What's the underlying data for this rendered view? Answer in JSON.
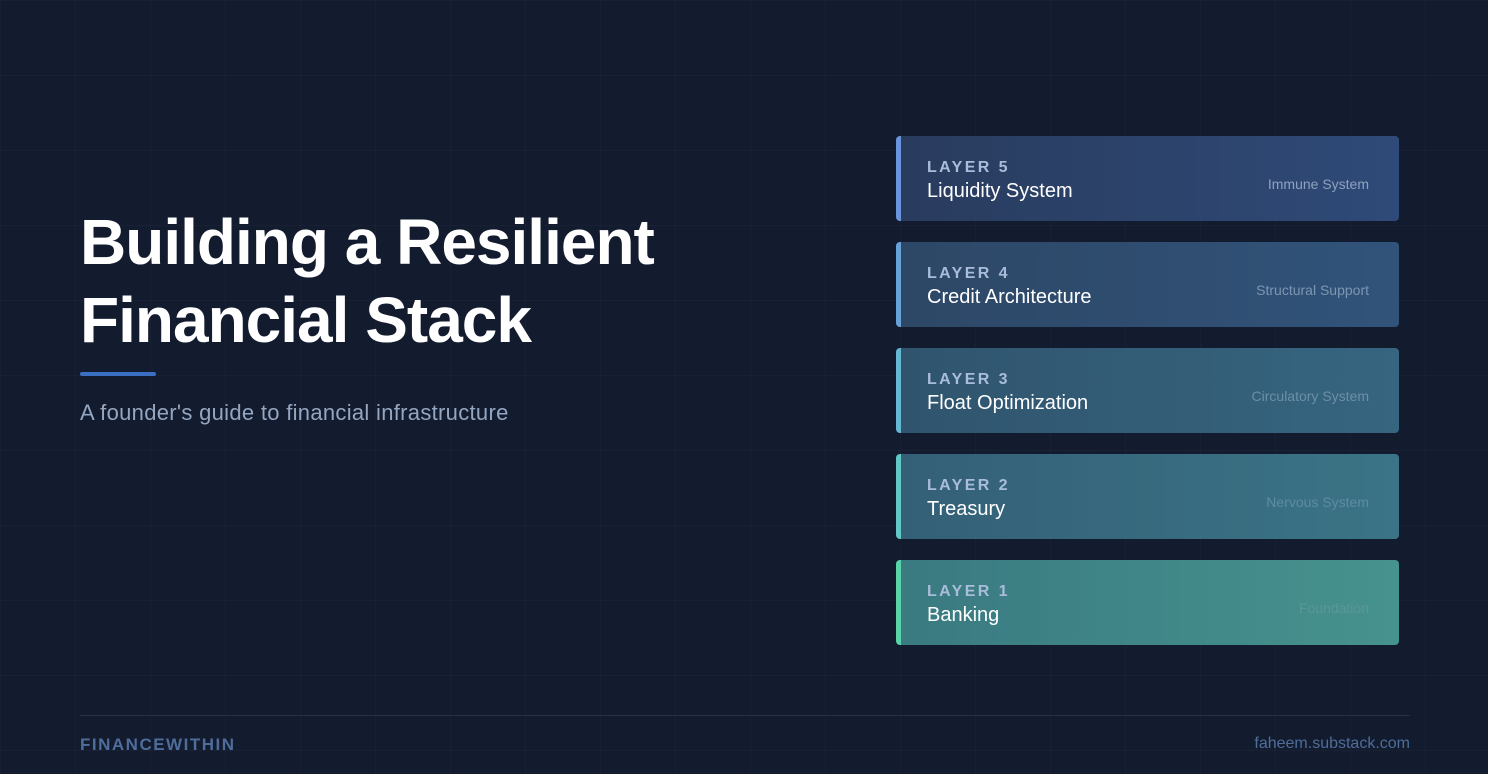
{
  "hero": {
    "title_line1": "Building a Resilient",
    "title_line2": "Financial Stack",
    "subtitle": "A founder's guide to financial infrastructure",
    "accent_color": "#3b6fc2"
  },
  "layers": [
    {
      "tag": "LAYER 5",
      "name": "Liquidity System",
      "role": "Immune System",
      "bg_from": "#293c5e",
      "bg_to": "#2f4a78",
      "border": "#6a94dc",
      "role_color": "#8ea2c0"
    },
    {
      "tag": "LAYER 4",
      "name": "Credit Architecture",
      "role": "Structural Support",
      "bg_from": "#2d4766",
      "bg_to": "#31537a",
      "border": "#67a2d8",
      "role_color": "#7d96b2"
    },
    {
      "tag": "LAYER 3",
      "name": "Float Optimization",
      "role": "Circulatory System",
      "bg_from": "#30546e",
      "bg_to": "#36657f",
      "border": "#66b7d3",
      "role_color": "#6c8ea8"
    },
    {
      "tag": "LAYER 2",
      "name": "Treasury",
      "role": "Nervous System",
      "bg_from": "#346077",
      "bg_to": "#3b7486",
      "border": "#62c8c5",
      "role_color": "#5d8ca3"
    },
    {
      "tag": "LAYER 1",
      "name": "Banking",
      "role": "Foundation",
      "bg_from": "#3a7a81",
      "bg_to": "#46928e",
      "border": "#59d4a8",
      "role_color": "#5c9798"
    }
  ],
  "footer": {
    "brand": "FINANCEWITHIN",
    "site": "faheem.substack.com"
  }
}
